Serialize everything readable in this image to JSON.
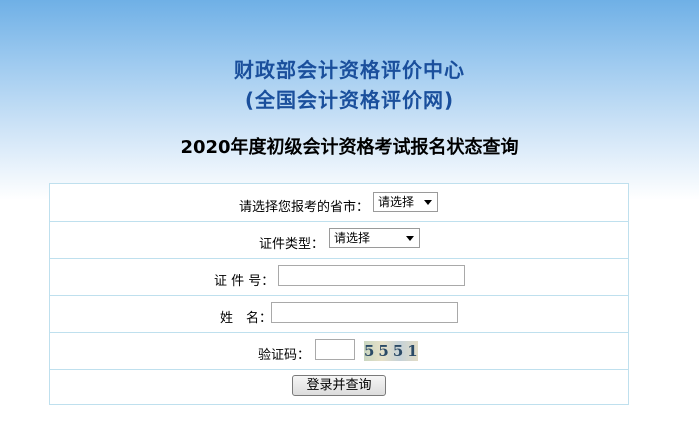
{
  "header": {
    "org_line1": "财政部会计资格评价中心",
    "org_line2": "(全国会计资格评价网)",
    "page_title": "2020年度初级会计资格考试报名状态查询"
  },
  "form": {
    "province_label": "请选择您报考的省市：",
    "province_value": "请选择",
    "id_type_label": "证件类型：",
    "id_type_value": "请选择",
    "id_number_label": "证 件 号：",
    "id_number_value": "",
    "name_label": "姓　名：",
    "name_value": "",
    "captcha_label": "验证码：",
    "captcha_value": "",
    "captcha_image_text": "5551",
    "submit_label": "登录并查询"
  },
  "colors": {
    "header_text": "#1a4f9c",
    "border": "#bfe0ee",
    "gradient_top": "#6fb0e6"
  }
}
